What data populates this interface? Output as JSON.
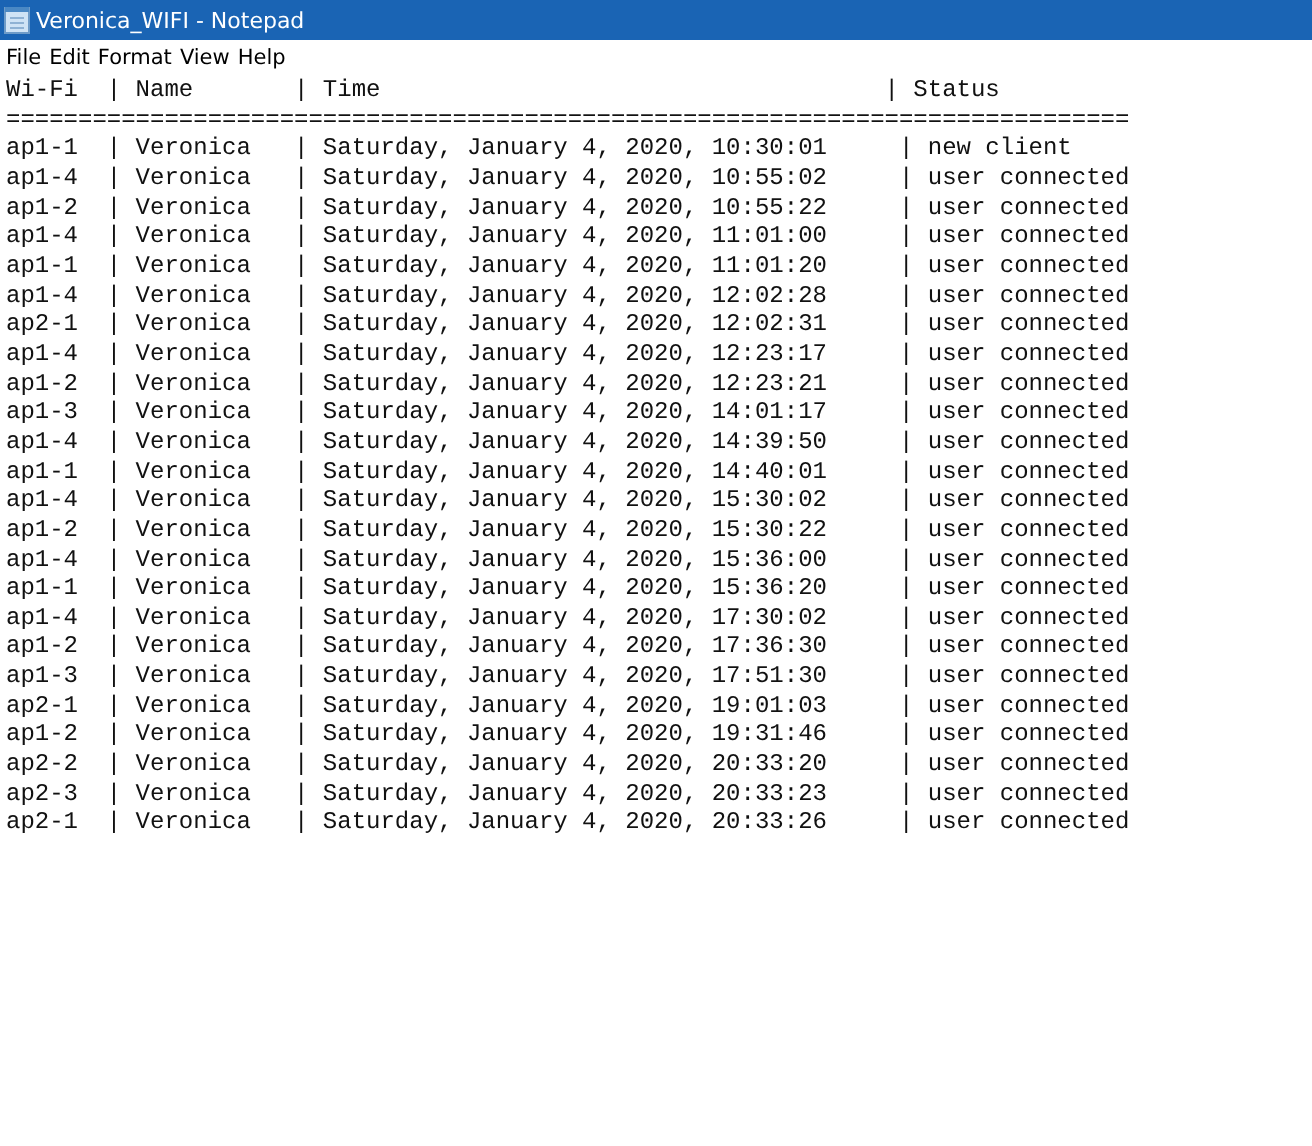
{
  "window": {
    "title": "Veronica_WIFI - Notepad"
  },
  "menu": [
    "File",
    "Edit",
    "Format",
    "View",
    "Help"
  ],
  "lines": [
    "Wi-Fi  | Name       | Time                                   | Status",
    "==============================================================================",
    "ap1-1  | Veronica   | Saturday, January 4, 2020, 10:30:01     | new client",
    "ap1-4  | Veronica   | Saturday, January 4, 2020, 10:55:02     | user connected",
    "ap1-2  | Veronica   | Saturday, January 4, 2020, 10:55:22     | user connected",
    "ap1-4  | Veronica   | Saturday, January 4, 2020, 11:01:00     | user connected",
    "ap1-1  | Veronica   | Saturday, January 4, 2020, 11:01:20     | user connected",
    "ap1-4  | Veronica   | Saturday, January 4, 2020, 12:02:28     | user connected",
    "ap2-1  | Veronica   | Saturday, January 4, 2020, 12:02:31     | user connected",
    "ap1-4  | Veronica   | Saturday, January 4, 2020, 12:23:17     | user connected",
    "ap1-2  | Veronica   | Saturday, January 4, 2020, 12:23:21     | user connected",
    "ap1-3  | Veronica   | Saturday, January 4, 2020, 14:01:17     | user connected",
    "ap1-4  | Veronica   | Saturday, January 4, 2020, 14:39:50     | user connected",
    "ap1-1  | Veronica   | Saturday, January 4, 2020, 14:40:01     | user connected",
    "ap1-4  | Veronica   | Saturday, January 4, 2020, 15:30:02     | user connected",
    "ap1-2  | Veronica   | Saturday, January 4, 2020, 15:30:22     | user connected",
    "ap1-4  | Veronica   | Saturday, January 4, 2020, 15:36:00     | user connected",
    "ap1-1  | Veronica   | Saturday, January 4, 2020, 15:36:20     | user connected",
    "ap1-4  | Veronica   | Saturday, January 4, 2020, 17:30:02     | user connected",
    "ap1-2  | Veronica   | Saturday, January 4, 2020, 17:36:30     | user connected",
    "ap1-3  | Veronica   | Saturday, January 4, 2020, 17:51:30     | user connected",
    "ap2-1  | Veronica   | Saturday, January 4, 2020, 19:01:03     | user connected",
    "ap1-2  | Veronica   | Saturday, January 4, 2020, 19:31:46     | user connected",
    "ap2-2  | Veronica   | Saturday, January 4, 2020, 20:33:20     | user connected",
    "ap2-3  | Veronica   | Saturday, January 4, 2020, 20:33:23     | user connected",
    "ap2-1  | Veronica   | Saturday, January 4, 2020, 20:33:26     | user connected"
  ]
}
